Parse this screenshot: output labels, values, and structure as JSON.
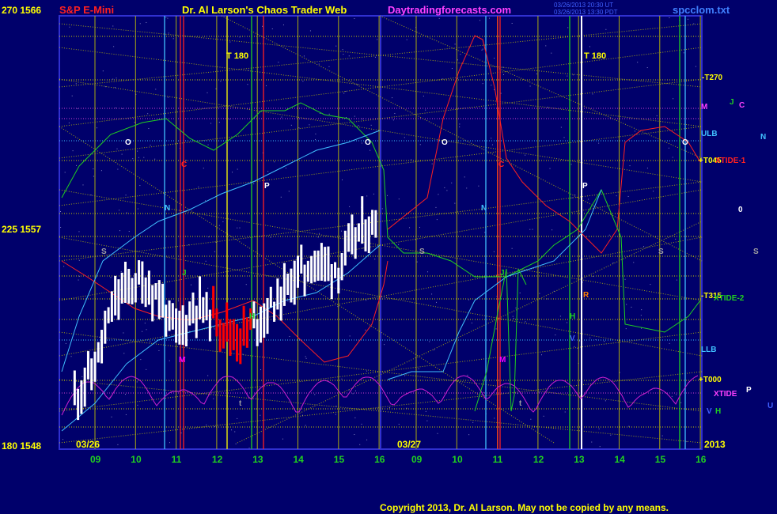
{
  "header": {
    "instrument": "S&P E-Mini",
    "title": "Dr. Al Larson's Chaos Trader Web",
    "site": "Daytradingforecasts.com",
    "timestamp1": "03/26/2013 20:30 UT",
    "timestamp2": "03/26/2013 13:30 PDT",
    "file": "spcclom.txt"
  },
  "left_axis": {
    "top": "270  1566",
    "mid": "225  1557",
    "bottom": "180  1548"
  },
  "footer": {
    "copyright": "Copyright 2013, Dr. Al Larson. May not be copied by any means.",
    "year": "2013"
  },
  "dates": {
    "d1": "03/26",
    "d2": "03/27"
  },
  "x_ticks": [
    "09",
    "10",
    "11",
    "12",
    "13",
    "14",
    "15",
    "16",
    "09",
    "10",
    "11",
    "12",
    "13",
    "14",
    "15",
    "16"
  ],
  "markers": {
    "t180_left": "T  180",
    "t180_right": "T  180"
  },
  "right_labels": {
    "t270": "-T270",
    "m": "M",
    "j": "J",
    "c": "C",
    "ulb": "ULB",
    "n": "N",
    "t045": "+T045",
    "xtide1": "XTIDE-1",
    "o": "0",
    "s": "S",
    "t315": "-T315",
    "xtide2": "XTIDE-2",
    "llb": "LLB",
    "t000": "+T000",
    "xtide": "XTIDE",
    "p": "P",
    "v": "V",
    "h": "H",
    "u": "U"
  },
  "planet_marks": {
    "left": {
      "o": "O",
      "c": "C",
      "p": "P",
      "n": "N",
      "s": "S",
      "j": "J",
      "m": "M",
      "h": "H",
      "t": "t",
      "v": "V"
    },
    "right": {
      "o": "O",
      "c": "C",
      "p": "P",
      "n": "N",
      "s": "S",
      "j": "J",
      "m": "M",
      "h": "H",
      "t": "t",
      "v": "V",
      "r": "R",
      "o2": "O"
    }
  },
  "colors": {
    "background": "#00006b",
    "grid": "#d8d800",
    "price_bars": "#ffffff",
    "price_down": "#ff0000",
    "red_line": "#ff2020",
    "green_line": "#20d020",
    "cyan_line": "#40c0ff",
    "magenta_line": "#d020d0",
    "yellow_text": "#ffff00",
    "red_text": "#ff2020",
    "magenta_text": "#ff00ff"
  },
  "chart_data": {
    "type": "line",
    "title": "S&P E-Mini",
    "ylabel_left": "270 1566 / 225 1557 / 180 1548",
    "y_range": [
      1548,
      1566
    ],
    "days": [
      "03/26",
      "03/27"
    ],
    "hours": [
      "09",
      "10",
      "11",
      "12",
      "13",
      "14",
      "15",
      "16"
    ],
    "price_series": {
      "name": "S&P E-Mini 5 min",
      "x_hours": [
        8.5,
        9.0,
        9.5,
        10.0,
        10.5,
        11.0,
        11.5,
        12.0,
        12.5,
        13.0,
        13.5,
        14.0,
        14.5,
        15.0,
        15.5,
        16.0
      ],
      "values": [
        1550.2,
        1551.4,
        1554.2,
        1555.0,
        1554.5,
        1552.8,
        1554.0,
        1553.5,
        1552.6,
        1553.4,
        1554.2,
        1555.3,
        1555.8,
        1555.5,
        1557.0,
        1557.4
      ]
    }
  }
}
